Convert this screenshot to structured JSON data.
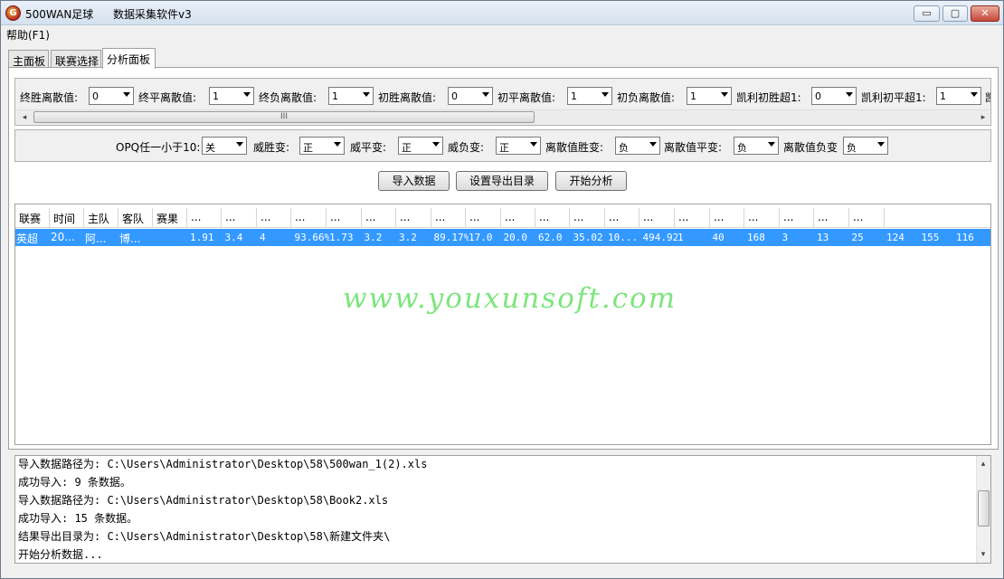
{
  "window": {
    "app_name": "500WAN足球",
    "subtitle": "数据采集软件v3",
    "min_label": "▭",
    "max_label": "▢",
    "close_label": "✕"
  },
  "menu": {
    "help": "帮助(F1)"
  },
  "tabs": [
    {
      "label": "主面板"
    },
    {
      "label": "联赛选择"
    },
    {
      "label": "分析面板",
      "active": true
    }
  ],
  "filters1": [
    {
      "label": "终胜离散值:",
      "value": "0"
    },
    {
      "label": "终平离散值:",
      "value": "1"
    },
    {
      "label": "终负离散值:",
      "value": "1"
    },
    {
      "label": "初胜离散值:",
      "value": "0"
    },
    {
      "label": "初平离散值:",
      "value": "1"
    },
    {
      "label": "初负离散值:",
      "value": "1"
    },
    {
      "label": "凯利初胜超1:",
      "value": "0"
    },
    {
      "label": "凯利初平超1:",
      "value": "1"
    },
    {
      "label": "凯"
    }
  ],
  "scrollbar": {
    "grip": "III",
    "left": "◂",
    "right": "▸"
  },
  "filters2": [
    {
      "label": "OPQ任一小于10:",
      "value": "关"
    },
    {
      "label": "威胜变:",
      "value": "正"
    },
    {
      "label": "威平变:",
      "value": "正"
    },
    {
      "label": "威负变:",
      "value": "正"
    },
    {
      "label": "离散值胜变:",
      "value": "负"
    },
    {
      "label": "离散值平变:",
      "value": "负"
    },
    {
      "label": "离散值负变",
      "value": "负"
    }
  ],
  "buttons": {
    "import": "导入数据",
    "export_dir": "设置导出目录",
    "analyze": "开始分析"
  },
  "grid": {
    "columns": [
      "联赛",
      "时间",
      "主队",
      "客队",
      "赛果",
      "...",
      "...",
      "...",
      "...",
      "...",
      "...",
      "...",
      "...",
      "...",
      "...",
      "...",
      "...",
      "...",
      "...",
      "...",
      "...",
      "...",
      "...",
      "...",
      "..."
    ],
    "row": [
      "英超",
      "20...",
      "阿...",
      "博...",
      "",
      "1.91",
      "3.4",
      "4",
      "93.66%",
      "1.73",
      "3.2",
      "3.2",
      "89.17%",
      "17.0",
      "20.0",
      "62.0",
      "35.02",
      "10...",
      "494.92",
      "1",
      "40",
      "168",
      "3",
      "13",
      "25",
      "124",
      "155",
      "116"
    ]
  },
  "watermark": "www.youxunsoft.com",
  "log": {
    "lines": [
      "导入数据路径为: C:\\Users\\Administrator\\Desktop\\58\\500wan_1(2).xls",
      "成功导入: 9 条数据。",
      "导入数据路径为: C:\\Users\\Administrator\\Desktop\\58\\Book2.xls",
      "成功导入: 15 条数据。",
      "结果导出目录为: C:\\Users\\Administrator\\Desktop\\58\\新建文件夹\\",
      "开始分析数据..."
    ],
    "up": "▴",
    "down": "▾"
  },
  "colors": {
    "selection": "#3399ff",
    "watermark": "#7de57d"
  }
}
